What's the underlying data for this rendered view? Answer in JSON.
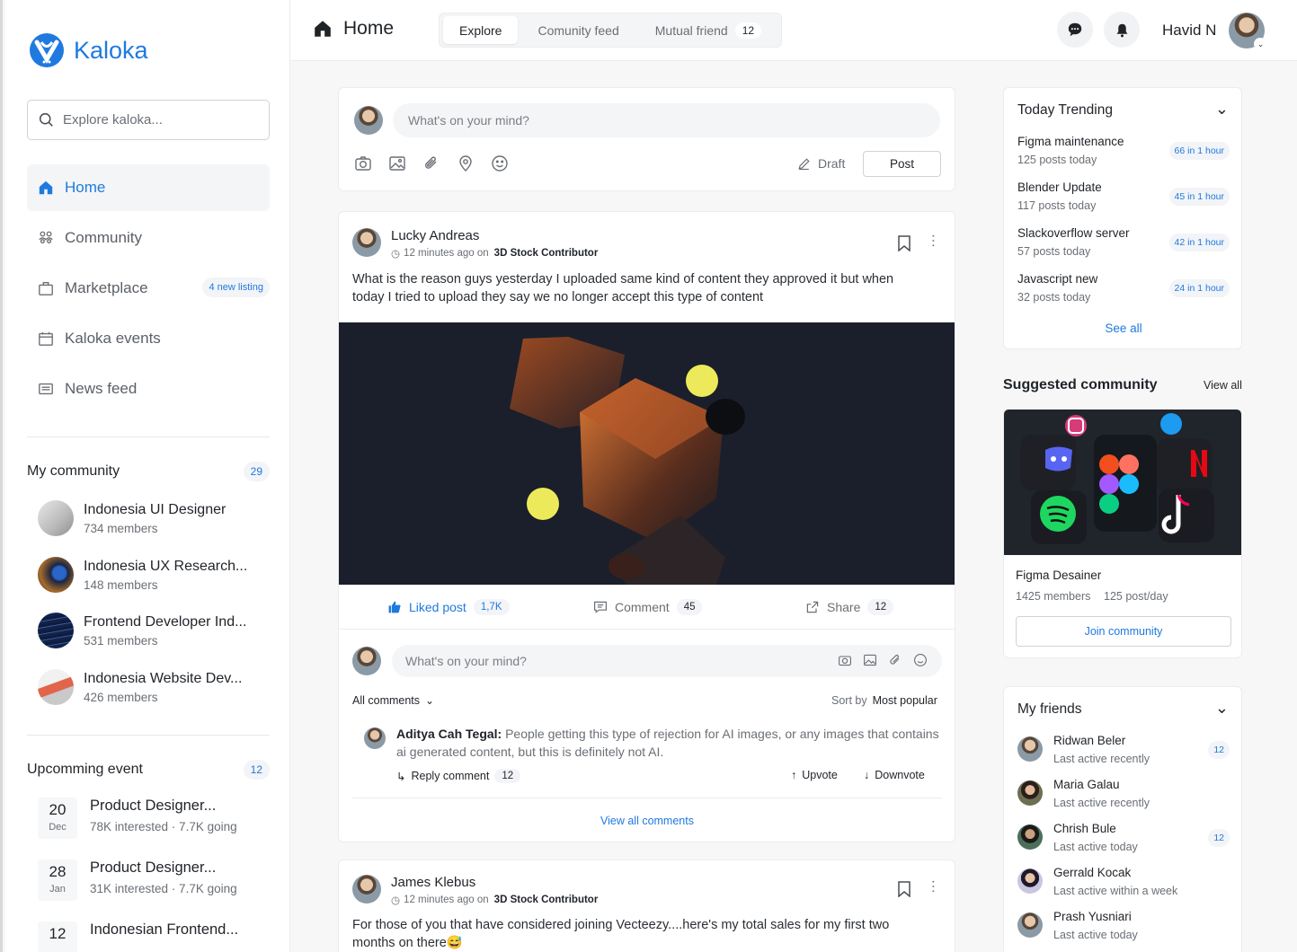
{
  "brand": {
    "name": "Kaloka",
    "color": "#1f7ae0"
  },
  "search": {
    "placeholder": "Explore kaloka..."
  },
  "nav": {
    "home": "Home",
    "community": "Community",
    "marketplace": "Marketplace",
    "marketplace_badge": "4 new listing",
    "events": "Kaloka events",
    "news": "News feed"
  },
  "my_community": {
    "title": "My community",
    "count": "29",
    "items": [
      {
        "name": "Indonesia UI Designer",
        "members": "734 members"
      },
      {
        "name": "Indonesia UX Research...",
        "members": "148 members"
      },
      {
        "name": "Frontend Developer Ind...",
        "members": "531 members"
      },
      {
        "name": "Indonesia Website Dev...",
        "members": "426 members"
      }
    ]
  },
  "events": {
    "title": "Upcomming event",
    "count": "12",
    "items": [
      {
        "day": "20",
        "month": "Dec",
        "name": "Product Designer...",
        "info": "78K interested · 7.7K going"
      },
      {
        "day": "28",
        "month": "Jan",
        "name": "Product Designer...",
        "info": "31K interested · 7.7K going"
      },
      {
        "day": "12",
        "month": "",
        "name": "Indonesian Frontend...",
        "info": ""
      }
    ]
  },
  "header": {
    "title": "Home",
    "tabs": {
      "explore": "Explore",
      "community": "Comunity feed",
      "mutual": "Mutual friend",
      "mutual_count": "12"
    },
    "user_name": "Havid N"
  },
  "composer": {
    "placeholder": "What's on your mind?",
    "draft": "Draft",
    "post": "Post"
  },
  "post1": {
    "author": "Lucky Andreas",
    "time": "12 minutes ago on",
    "role": "3D Stock Contributor",
    "text": "What is the reason guys yesterday I uploaded same kind of content they approved it but when today I tried to upload they say we no longer accept this type of content",
    "liked": "Liked post",
    "likes": "1,7K",
    "comment": "Comment",
    "comments": "45",
    "share": "Share",
    "shares": "12",
    "reply_placeholder": "What's on your mind?",
    "all_comments": "All comments",
    "sort_label": "Sort by",
    "sort_value": "Most popular",
    "c_author": "Aditya Cah Tegal:",
    "c_text": "People getting this type of rejection for AI images, or any images that contains ai generated content, but this is definitely not AI.",
    "reply": "Reply comment",
    "reply_count": "12",
    "upvote": "Upvote",
    "downvote": "Downvote",
    "view_all": "View all comments"
  },
  "post2": {
    "author": "James Klebus",
    "time": "12 minutes ago on",
    "role": "3D Stock Contributor",
    "text": "For those of you that have considered joining Vecteezy....here's my total sales for my first two months on there😅"
  },
  "trending": {
    "title": "Today Trending",
    "items": [
      {
        "title": "Figma maintenance",
        "sub": "125 posts today",
        "pill": "66 in 1 hour"
      },
      {
        "title": "Blender Update",
        "sub": "117 posts today",
        "pill": "45 in 1 hour"
      },
      {
        "title": "Slackoverflow server",
        "sub": "57 posts today",
        "pill": "42 in 1 hour"
      },
      {
        "title": "Javascript new",
        "sub": "32 posts today",
        "pill": "24 in 1 hour"
      }
    ],
    "see_all": "See all"
  },
  "suggested": {
    "title": "Suggested community",
    "view_all": "View all",
    "name": "Figma Desainer",
    "members": "1425 members",
    "rate": "125 post/day",
    "join": "Join community"
  },
  "friends": {
    "title": "My friends",
    "items": [
      {
        "name": "Ridwan Beler",
        "status": "Last active recently",
        "count": "12"
      },
      {
        "name": "Maria Galau",
        "status": "Last active recently",
        "count": ""
      },
      {
        "name": "Chrish Bule",
        "status": "Last active today",
        "count": "12"
      },
      {
        "name": "Gerrald Kocak",
        "status": "Last active within a week",
        "count": ""
      },
      {
        "name": "Prash Yusniari",
        "status": "Last active today",
        "count": ""
      }
    ]
  }
}
